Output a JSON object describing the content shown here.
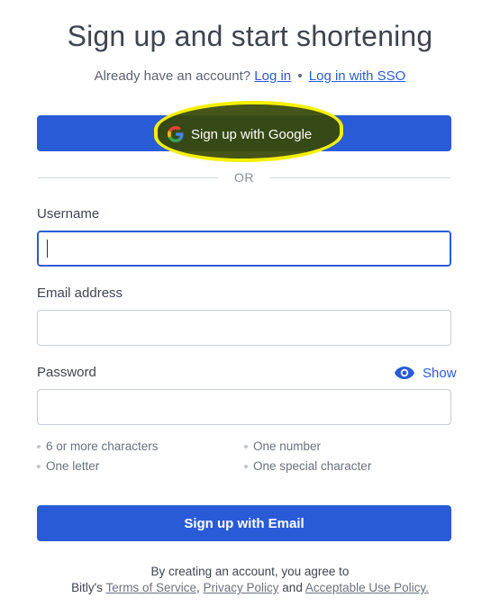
{
  "page": {
    "title": "Sign up and start shortening"
  },
  "login": {
    "prompt": "Already have an account?",
    "login_link": "Log in",
    "separator": "•",
    "sso_link": "Log in with SSO"
  },
  "google_button": {
    "label": "Sign up with Google",
    "icon": "google-g-icon"
  },
  "divider": {
    "text": "OR"
  },
  "form": {
    "username_label": "Username",
    "username_value": "",
    "email_label": "Email address",
    "email_value": "",
    "password_label": "Password",
    "password_value": "",
    "show_label": "Show",
    "show_icon": "eye-icon"
  },
  "requirements": [
    "6 or more characters",
    "One number",
    "One letter",
    "One special character"
  ],
  "email_button": {
    "label": "Sign up with Email"
  },
  "terms": {
    "line1": "By creating an account, you agree to",
    "prefix": "Bitly's",
    "terms_link": "Terms of Service",
    "comma": ",",
    "privacy_link": "Privacy Policy",
    "and": "and",
    "aup_link": "Acceptable Use Policy."
  },
  "colors": {
    "primary": "#2a5bd7",
    "highlight": "#f4f000"
  }
}
